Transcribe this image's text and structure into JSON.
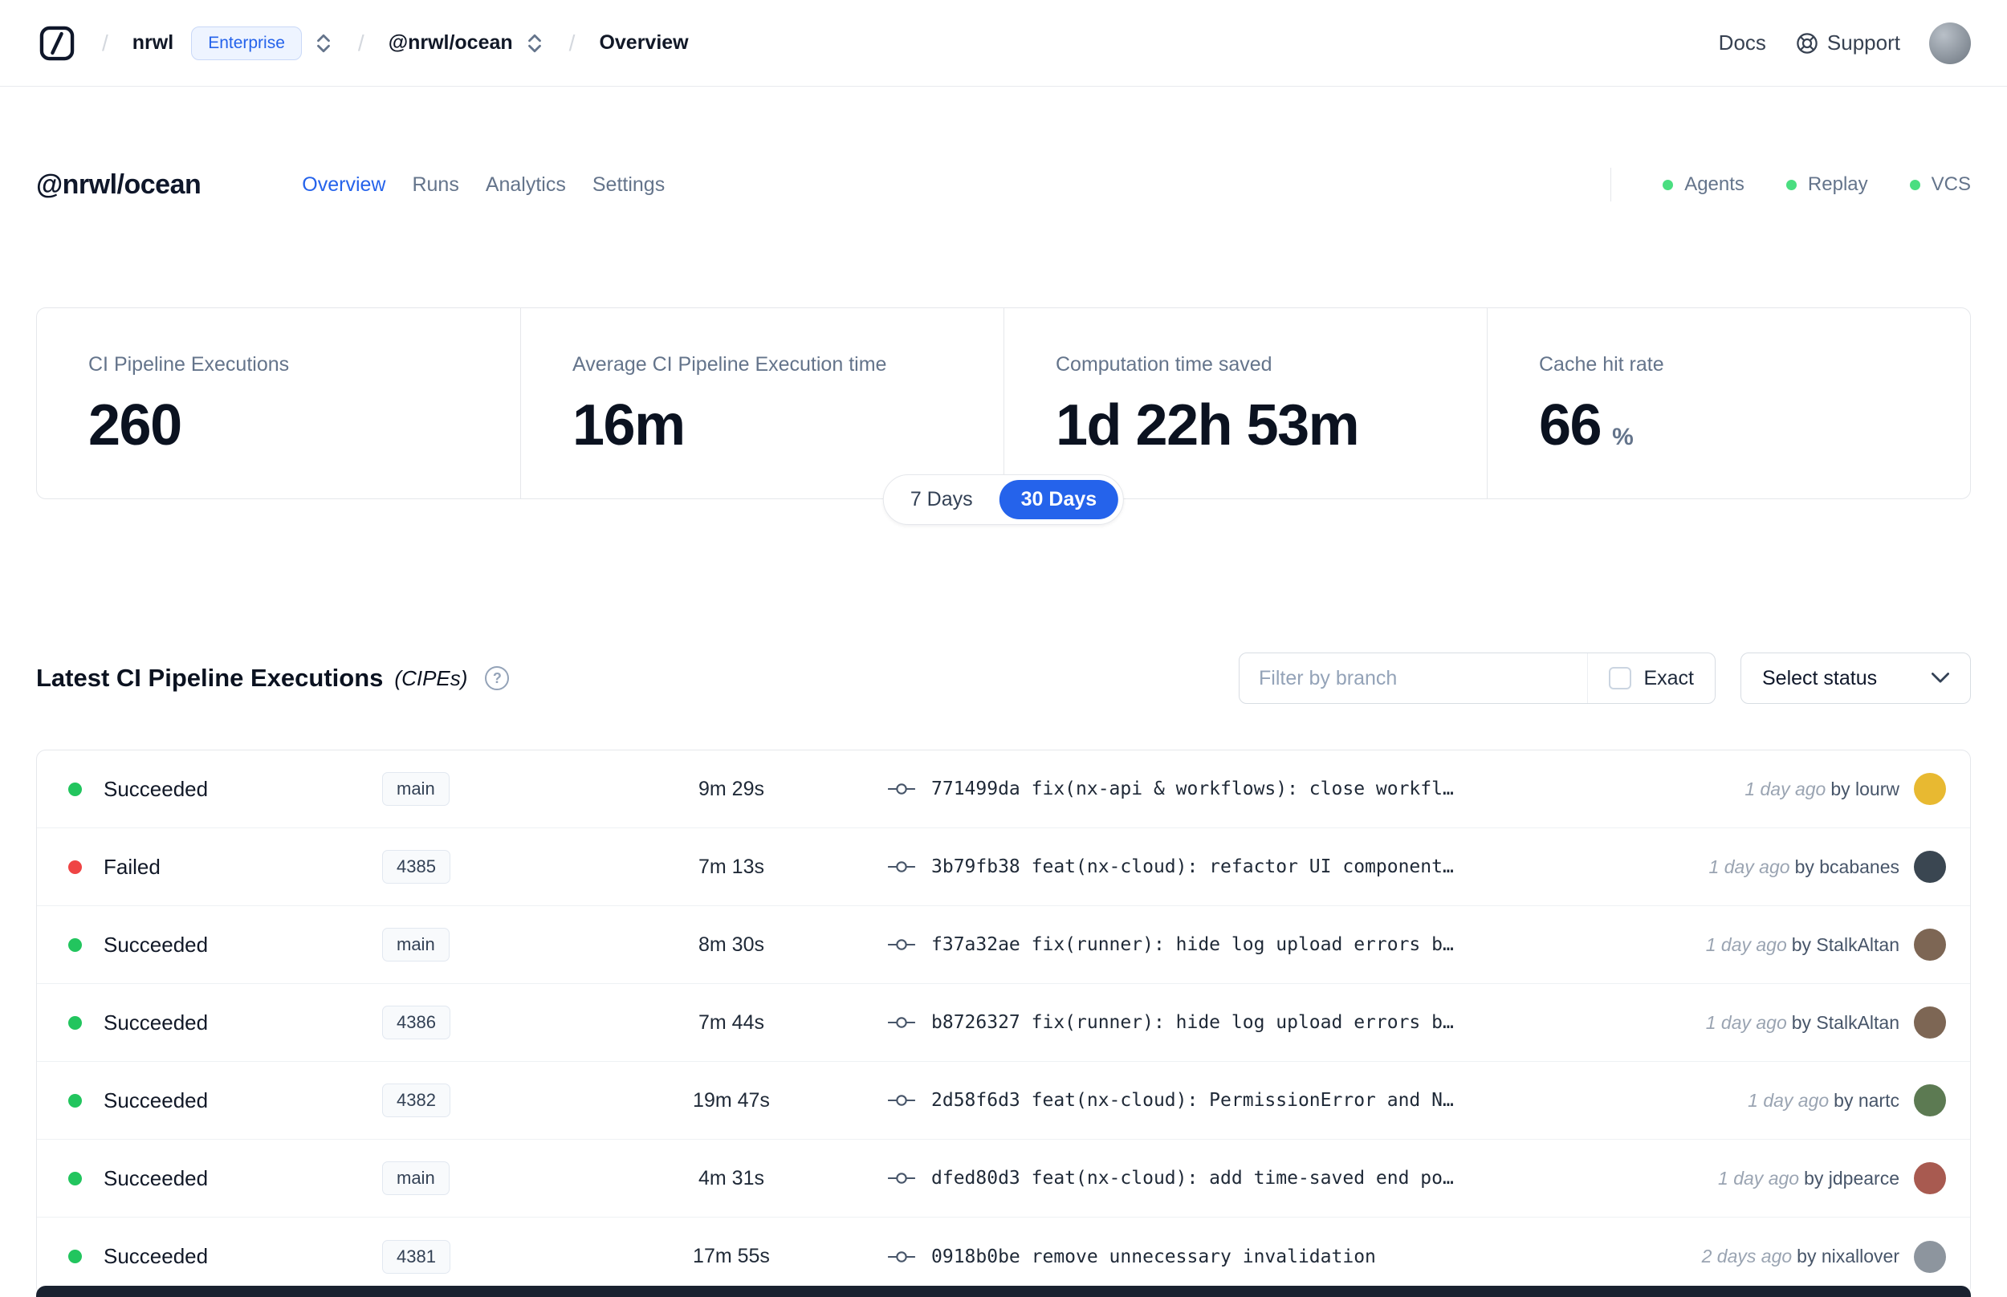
{
  "navbar": {
    "separator": "/",
    "breadcrumb": {
      "org": "nrwl",
      "org_badge": "Enterprise",
      "workspace": "@nrwl/ocean",
      "page": "Overview"
    },
    "docs_label": "Docs",
    "support_label": "Support"
  },
  "workspace_header": {
    "title": "@nrwl/ocean",
    "tabs": [
      {
        "label": "Overview"
      },
      {
        "label": "Runs"
      },
      {
        "label": "Analytics"
      },
      {
        "label": "Settings"
      }
    ],
    "indicators": [
      {
        "label": "Agents",
        "color": "#4ade80"
      },
      {
        "label": "Replay",
        "color": "#4ade80"
      },
      {
        "label": "VCS",
        "color": "#4ade80"
      }
    ]
  },
  "stats": {
    "cards": [
      {
        "label": "CI Pipeline Executions",
        "value": "260",
        "suffix": ""
      },
      {
        "label": "Average CI Pipeline Execution time",
        "value": "16m",
        "suffix": ""
      },
      {
        "label": "Computation time saved",
        "value": "1d 22h 53m",
        "suffix": ""
      },
      {
        "label": "Cache hit rate",
        "value": "66",
        "suffix": "%"
      }
    ],
    "range_toggle": [
      {
        "label": "7 Days"
      },
      {
        "label": "30 Days"
      }
    ]
  },
  "cipe": {
    "title": "Latest CI Pipeline Executions",
    "title_suffix": "(CIPEs)",
    "help_glyph": "?",
    "filter_placeholder": "Filter by branch",
    "exact_label": "Exact",
    "select_status_label": "Select status",
    "rows": [
      {
        "status": "Succeeded",
        "status_color": "#22c55e",
        "branch": "main",
        "duration": "9m 29s",
        "commit": "771499da fix(nx-api & workflows): close workfl…",
        "time": "1 day ago",
        "author": "by lourw",
        "avatar_color": "#e8b931"
      },
      {
        "status": "Failed",
        "status_color": "#ef4444",
        "branch": "4385",
        "duration": "7m 13s",
        "commit": "3b79fb38 feat(nx-cloud): refactor UI component…",
        "time": "1 day ago",
        "author": "by bcabanes",
        "avatar_color": "#3a4651"
      },
      {
        "status": "Succeeded",
        "status_color": "#22c55e",
        "branch": "main",
        "duration": "8m 30s",
        "commit": "f37a32ae fix(runner): hide log upload errors b…",
        "time": "1 day ago",
        "author": "by StalkAltan",
        "avatar_color": "#7d6654"
      },
      {
        "status": "Succeeded",
        "status_color": "#22c55e",
        "branch": "4386",
        "duration": "7m 44s",
        "commit": "b8726327 fix(runner): hide log upload errors b…",
        "time": "1 day ago",
        "author": "by StalkAltan",
        "avatar_color": "#7d6654"
      },
      {
        "status": "Succeeded",
        "status_color": "#22c55e",
        "branch": "4382",
        "duration": "19m 47s",
        "commit": "2d58f6d3 feat(nx-cloud): PermissionError and N…",
        "time": "1 day ago",
        "author": "by nartc",
        "avatar_color": "#5c7a52"
      },
      {
        "status": "Succeeded",
        "status_color": "#22c55e",
        "branch": "main",
        "duration": "4m 31s",
        "commit": "dfed80d3 feat(nx-cloud): add time-saved end po…",
        "time": "1 day ago",
        "author": "by jdpearce",
        "avatar_color": "#a85a50"
      },
      {
        "status": "Succeeded",
        "status_color": "#22c55e",
        "branch": "4381",
        "duration": "17m 55s",
        "commit": "0918b0be remove unnecessary invalidation",
        "time": "2 days ago",
        "author": "by nixallover",
        "avatar_color": "#8d959e"
      }
    ]
  },
  "colors": {
    "accent": "#2563eb",
    "success": "#22c55e",
    "danger": "#ef4444"
  }
}
